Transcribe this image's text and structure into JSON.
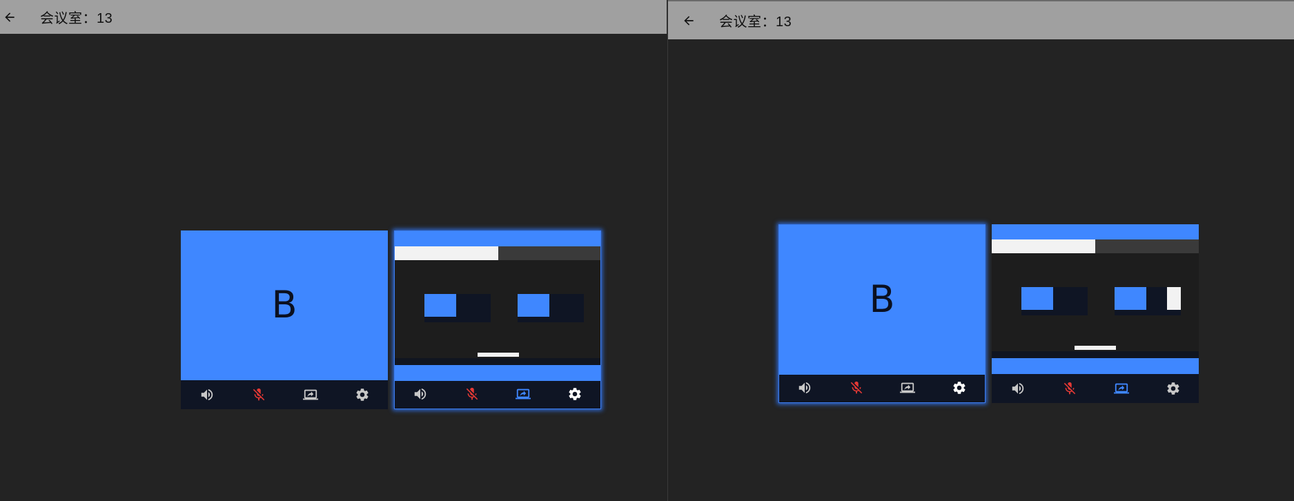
{
  "windows": [
    {
      "title": "会议室：13",
      "tiles": [
        {
          "avatar": "B",
          "controls": [
            "volume-icon",
            "mic-off-icon",
            "screen-share-icon",
            "settings-icon"
          ],
          "share_active": false,
          "active": false
        },
        {
          "avatar": "",
          "controls": [
            "volume-icon",
            "mic-off-icon",
            "screen-share-icon",
            "settings-icon"
          ],
          "share_active": true,
          "active": true
        }
      ]
    },
    {
      "title": "会议室：13",
      "tiles": [
        {
          "avatar": "B",
          "controls": [
            "volume-icon",
            "mic-off-icon",
            "screen-share-icon",
            "settings-icon"
          ],
          "share_active": false,
          "active": true
        },
        {
          "avatar": "",
          "controls": [
            "volume-icon",
            "mic-off-icon",
            "screen-share-icon",
            "settings-icon"
          ],
          "share_active": true,
          "active": false
        }
      ]
    }
  ],
  "colors": {
    "mic_off": "#e53935",
    "share_active": "#3f87ff",
    "icon_default": "#c8c8c8",
    "tile_video": "#3f87ff"
  }
}
